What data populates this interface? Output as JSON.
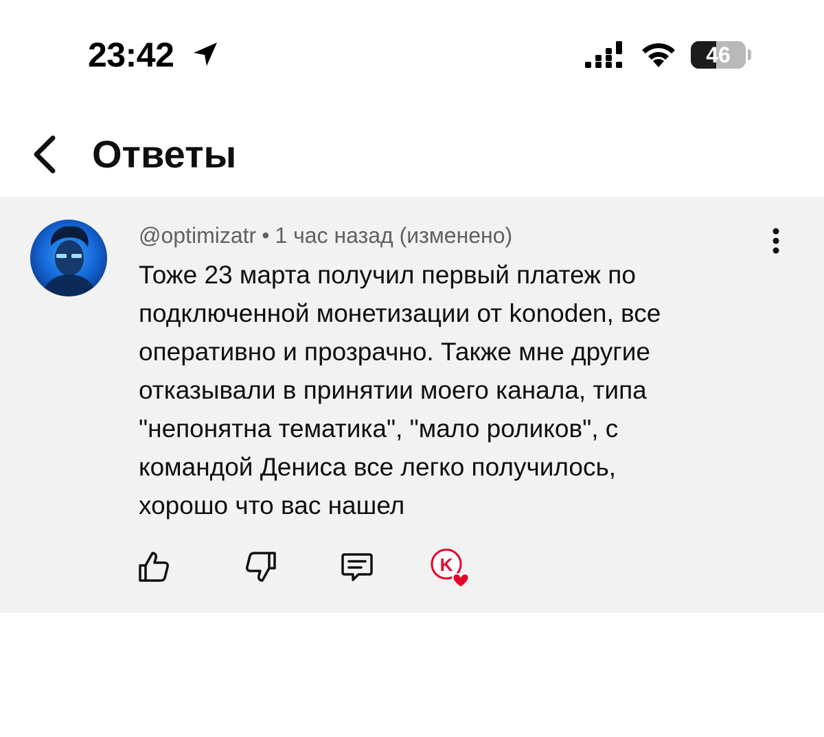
{
  "status_bar": {
    "time": "23:42",
    "battery_level": "46",
    "battery_fraction": 0.46
  },
  "header": {
    "title": "Ответы",
    "back_icon": "chevron-left-icon"
  },
  "comment": {
    "author": "@optimizatr",
    "separator": "•",
    "timestamp": "1 час назад (изменено)",
    "text_lines": [
      "Тоже 23 марта получил первый платеж по",
      "подключенной монетизации от konoden, все",
      "оперативно и прозрачно. Также мне другие",
      "отказывали в принятии моего канала, типа",
      "\"непонятна тематика\", \"мало роликов\", с",
      "командой Дениса все легко получилось,",
      "хорошо что вас нашел"
    ],
    "actions": {
      "like_icon": "thumbs-up-icon",
      "dislike_icon": "thumbs-down-icon",
      "reply_icon": "reply-icon",
      "creator_heart_icon": "creator-heart-icon",
      "creator_badge_letter": "K"
    }
  },
  "colors": {
    "card_background": "#f2f2f2",
    "text_primary": "#0f0f0f",
    "text_secondary": "#606060",
    "heart_red": "#e8002d"
  }
}
